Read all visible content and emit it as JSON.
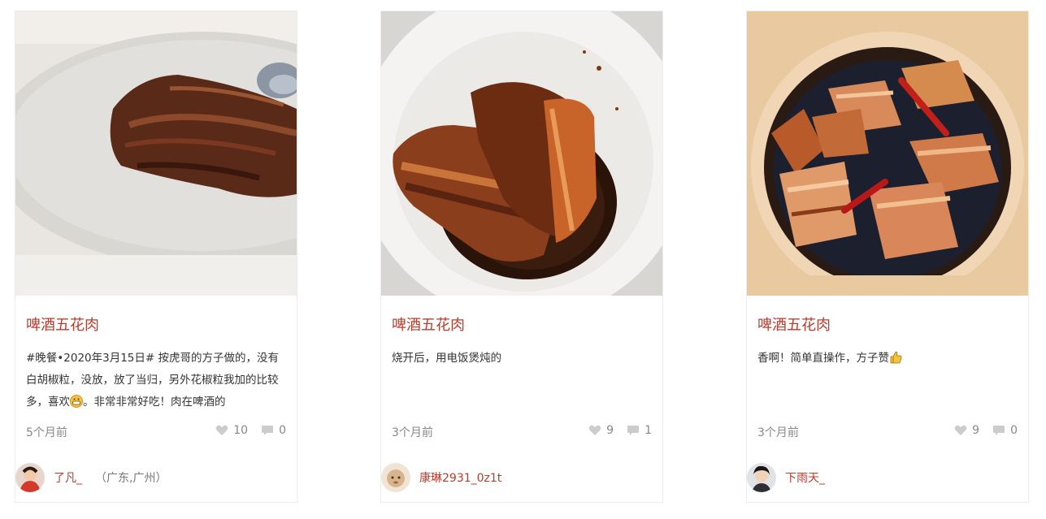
{
  "cards": [
    {
      "title": "啤酒五花肉",
      "description_parts": [
        "#晚餐•2020年3月15日# 按虎哥的方子做的，没有白胡椒粒，没放，放了当归，另外花椒粒我加的比较多，喜欢",
        "。非常非常好吃！肉在啤酒的"
      ],
      "time": "5个月前",
      "likes": "10",
      "comments": "0",
      "author": "了凡_",
      "location": "（广东,广州）"
    },
    {
      "title": "啤酒五花肉",
      "description": "烧开后，用电饭煲炖的",
      "time": "3个月前",
      "likes": "9",
      "comments": "1",
      "author": "康琳2931_0z1t",
      "location": ""
    },
    {
      "title": "啤酒五花肉",
      "description": "香啊！简单直操作，方子赞",
      "time": "3个月前",
      "likes": "9",
      "comments": "0",
      "author": "下雨天_",
      "location": ""
    }
  ],
  "icons": {
    "like": "heart-icon",
    "comment": "comment-icon",
    "emoji_grin": "grin-emoji-icon",
    "emoji_thumb": "thumbs-up-emoji-icon"
  },
  "colors": {
    "accent": "#c0392b",
    "muted": "#888888",
    "icon": "#cccccc"
  }
}
